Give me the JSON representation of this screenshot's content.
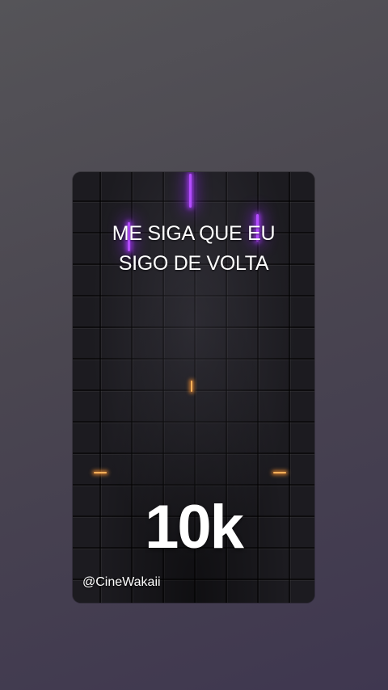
{
  "video_card": {
    "headline_line1": "ME SIGA QUE EU",
    "headline_line2": "SIGO DE VOLTA",
    "count": "10k",
    "handle": "@CineWakaii"
  },
  "colors": {
    "accent_purple": "#b44dff",
    "accent_orange": "#ffb15a"
  }
}
